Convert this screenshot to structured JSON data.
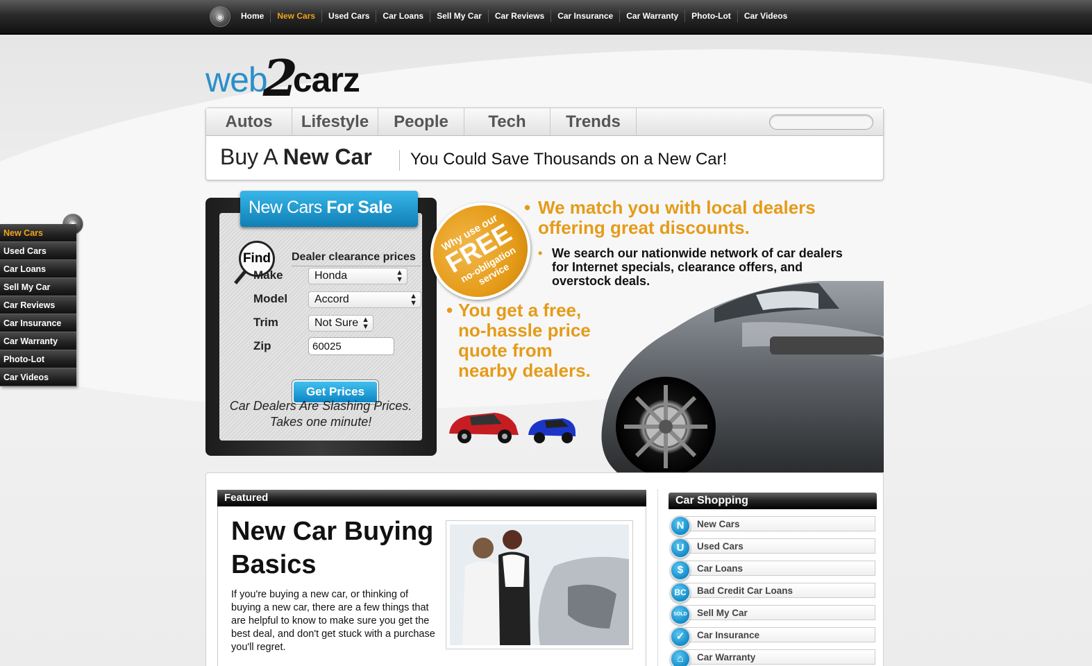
{
  "topnav": {
    "items": [
      "Home",
      "New Cars",
      "Used Cars",
      "Car Loans",
      "Sell My Car",
      "Car Reviews",
      "Car Insurance",
      "Car Warranty",
      "Photo-Lot",
      "Car Videos"
    ],
    "active": "New Cars"
  },
  "brand": {
    "part1": "web",
    "part2": "2",
    "part3": "carz"
  },
  "tabs": [
    "Autos",
    "Lifestyle",
    "People",
    "Tech",
    "Trends"
  ],
  "search": {
    "placeholder": ""
  },
  "headline": {
    "prefix": "Buy A",
    "bold": "New Car",
    "subtitle": "You Could Save Thousands on a New Car!"
  },
  "sidenav": {
    "items": [
      "New Cars",
      "Used Cars",
      "Car Loans",
      "Sell My Car",
      "Car Reviews",
      "Car Insurance",
      "Car Warranty",
      "Photo-Lot",
      "Car Videos"
    ],
    "active": "New Cars"
  },
  "finder": {
    "title_light": "New Cars",
    "title_bold": "For Sale",
    "find_label": "Find",
    "subtitle": "Dealer clearance prices",
    "make_label": "Make",
    "make_value": "Honda",
    "model_label": "Model",
    "model_value": "Accord",
    "trim_label": "Trim",
    "trim_value": "Not Sure",
    "zip_label": "Zip",
    "zip_value": "60025",
    "button": "Get Prices",
    "footer": "Car Dealers Are Slashing Prices. Takes one minute!"
  },
  "promo": {
    "sticker_line1": "Why use our",
    "sticker_line2": "FREE",
    "sticker_line3": "no-obligation service",
    "bullet1": "We match you with local dealers offering great discounts.",
    "bullet2": "We search our nationwide network of car dealers for Internet specials, clearance offers, and overstock deals.",
    "bullet3": "You get a free, no-hassle price quote from nearby dealers."
  },
  "featured": {
    "header": "Featured",
    "title": "New Car Buying Basics",
    "text": "If you're buying a new car, or thinking of buying a new car, there are a few things that are helpful to know to make sure you get the best deal, and don't get stuck with a purchase you'll regret."
  },
  "shopping": {
    "header": "Car Shopping",
    "items": [
      {
        "icon": "N",
        "label": "New Cars"
      },
      {
        "icon": "U",
        "label": "Used Cars"
      },
      {
        "icon": "$",
        "label": "Car Loans"
      },
      {
        "icon": "BC",
        "label": "Bad Credit Car Loans"
      },
      {
        "icon": "SOLD",
        "label": "Sell My Car"
      },
      {
        "icon": "✓",
        "label": "Car Insurance"
      },
      {
        "icon": "⌂",
        "label": "Car Warranty"
      }
    ]
  },
  "colors": {
    "accent_orange": "#e59b18",
    "accent_blue": "#1a8fcb",
    "bar_dark": "#222222"
  }
}
